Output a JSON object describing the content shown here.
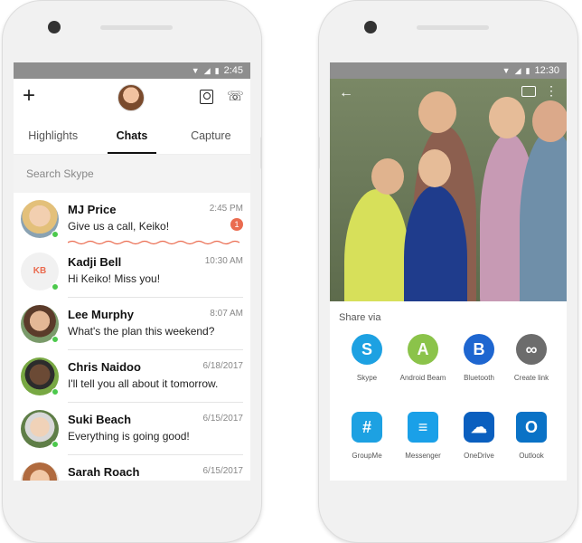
{
  "left_phone": {
    "status_time": "2:45",
    "tabs": [
      {
        "label": "Highlights"
      },
      {
        "label": "Chats"
      },
      {
        "label": "Capture"
      }
    ],
    "search_placeholder": "Search Skype",
    "chats": [
      {
        "name": "MJ Price",
        "message": "Give us a call, Keiko!",
        "time": "2:45 PM",
        "badge": "1"
      },
      {
        "name": "Kadji Bell",
        "message": "Hi Keiko! Miss you!",
        "time": "10:30 AM",
        "initials": "KB"
      },
      {
        "name": "Lee Murphy",
        "message": "What's the plan this weekend?",
        "time": "8:07 AM"
      },
      {
        "name": "Chris Naidoo",
        "message": "I'll tell you all about it tomorrow.",
        "time": "6/18/2017"
      },
      {
        "name": "Suki Beach",
        "message": "Everything is going good!",
        "time": "6/15/2017"
      },
      {
        "name": "Sarah Roach",
        "message": "",
        "time": "6/15/2017"
      }
    ]
  },
  "right_phone": {
    "status_time": "12:30",
    "share_title": "Share via",
    "apps": [
      {
        "label": "Skype",
        "color": "#1da1e2",
        "glyph": "S"
      },
      {
        "label": "Android Beam",
        "color": "#8bc34a",
        "glyph": "A"
      },
      {
        "label": "Bluetooth",
        "color": "#1e66d0",
        "glyph": "B"
      },
      {
        "label": "Create link",
        "color": "#6c6c6c",
        "glyph": "∞"
      },
      {
        "label": "GroupMe",
        "color": "#1da1e2",
        "glyph": "#"
      },
      {
        "label": "Messenger",
        "color": "#1aa0e8",
        "glyph": "≡"
      },
      {
        "label": "OneDrive",
        "color": "#0a5fbf",
        "glyph": "☁"
      },
      {
        "label": "Outlook",
        "color": "#0a72c6",
        "glyph": "O"
      }
    ]
  }
}
